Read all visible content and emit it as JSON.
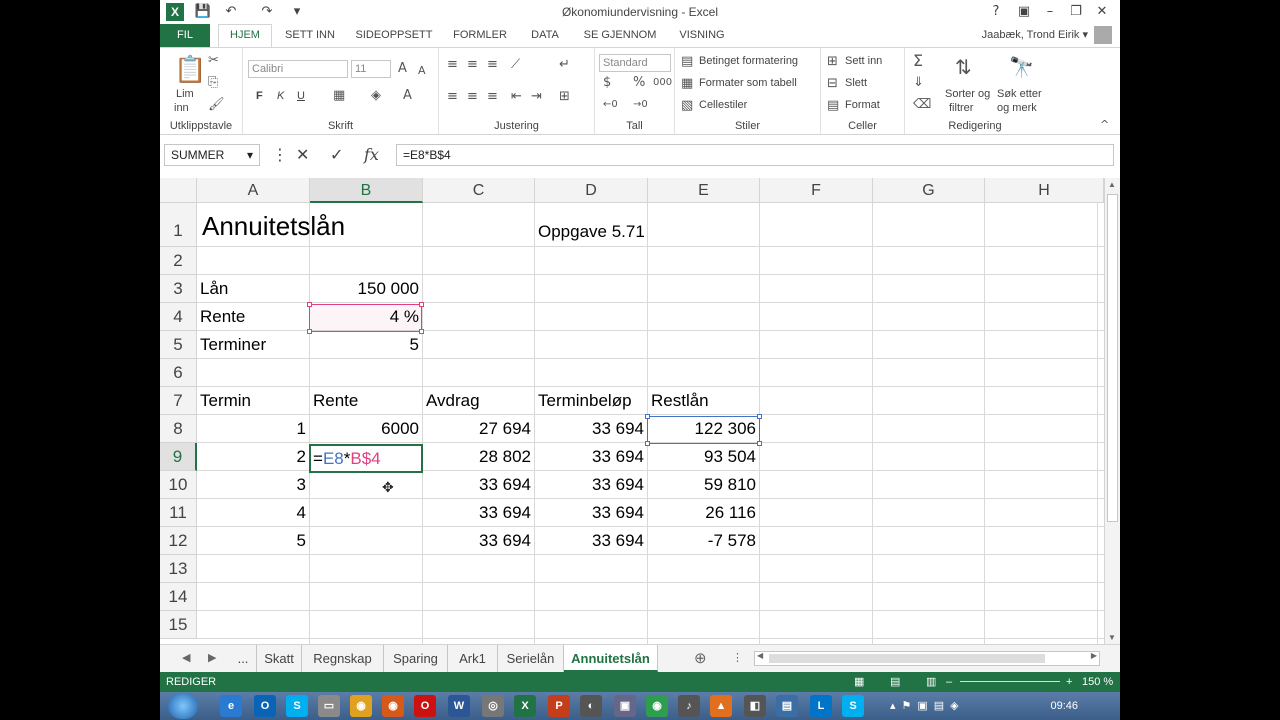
{
  "titlebar": {
    "title": "Økonomiundervisning - Excel",
    "logo": "X",
    "help": "?"
  },
  "tabs": {
    "file": "FIL",
    "items": [
      "HJEM",
      "SETT INN",
      "SIDEOPPSETT",
      "FORMLER",
      "DATA",
      "SE GJENNOM",
      "VISNING"
    ],
    "user": "Jaabæk, Trond Eirik"
  },
  "ribbon": {
    "clipboard": {
      "paste": "Lim",
      "paste2": "inn",
      "label": "Utklippstavle"
    },
    "font": {
      "name": "Calibri",
      "size": "11",
      "bold": "F",
      "italic": "K",
      "underline": "U",
      "label": "Skrift"
    },
    "alignment": {
      "label": "Justering"
    },
    "number": {
      "format": "Standard",
      "label": "Tall"
    },
    "styles": {
      "cond": "Betinget formatering",
      "table": "Formater som tabell",
      "cell": "Cellestiler",
      "label": "Stiler"
    },
    "cells": {
      "insert": "Sett inn",
      "delete": "Slett",
      "format": "Format",
      "label": "Celler"
    },
    "editing": {
      "sort": "Sorter og",
      "sort2": "filtrer",
      "find": "Søk etter",
      "find2": "og merk",
      "label": "Redigering"
    }
  },
  "formula_bar": {
    "name_box": "SUMMER",
    "formula": "=E8*B$4"
  },
  "grid": {
    "columns": [
      "A",
      "B",
      "C",
      "D",
      "E",
      "F",
      "G",
      "H"
    ],
    "rows": [
      "1",
      "2",
      "3",
      "4",
      "5",
      "6",
      "7",
      "8",
      "9",
      "10",
      "11",
      "12",
      "13",
      "14",
      "15"
    ],
    "title": "Annuitetslån",
    "task": "Oppgave 5.71",
    "loan_label": "Lån",
    "loan_value": "150 000",
    "rate_label": "Rente",
    "rate_value": "4 %",
    "terms_label": "Terminer",
    "terms_value": "5",
    "headers": [
      "Termin",
      "Rente",
      "Avdrag",
      "Terminbeløp",
      "Restlån"
    ],
    "table": [
      {
        "termin": "1",
        "rente": "6000",
        "avdrag": "27 694",
        "terminbelop": "33 694",
        "restlan": "122 306"
      },
      {
        "termin": "2",
        "rente": "",
        "avdrag": "28 802",
        "terminbelop": "33 694",
        "restlan": "93 504"
      },
      {
        "termin": "3",
        "rente": "",
        "avdrag": "33 694",
        "terminbelop": "33 694",
        "restlan": "59 810"
      },
      {
        "termin": "4",
        "rente": "",
        "avdrag": "33 694",
        "terminbelop": "33 694",
        "restlan": "26 116"
      },
      {
        "termin": "5",
        "rente": "",
        "avdrag": "33 694",
        "terminbelop": "33 694",
        "restlan": "-7 578"
      }
    ],
    "editing_cell": {
      "eq": "=",
      "ref1": "E8",
      "op": "*",
      "ref2": "B$4",
      "color1": "#4472c4",
      "color2": "#e04080"
    }
  },
  "sheets": {
    "ellipsis": "...",
    "tabs": [
      "Skatt",
      "Regnskap",
      "Sparing",
      "Ark1",
      "Serielån",
      "Annuitetslån"
    ],
    "active": "Annuitetslån"
  },
  "status": {
    "mode": "REDIGER",
    "zoom": "150 %"
  },
  "taskbar": {
    "time": "09:46"
  },
  "colors": {
    "accent": "#217346",
    "ref_blue": "#4472c4",
    "ref_pink": "#e04080"
  }
}
